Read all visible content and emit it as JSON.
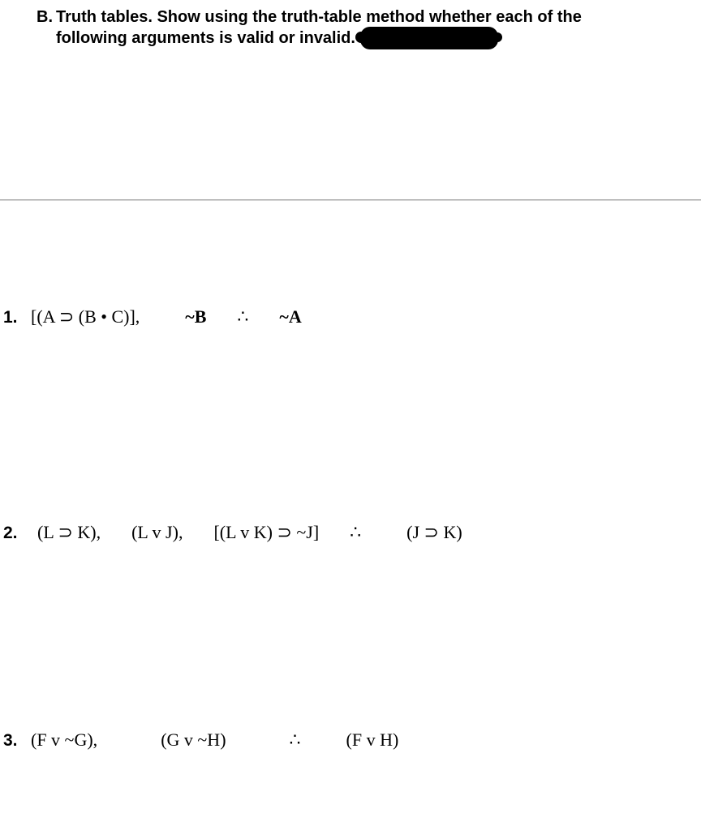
{
  "header": {
    "section_label": "B.",
    "line1": "Truth tables. Show using the truth-table method whether each of the",
    "line2": "following arguments is valid or invalid."
  },
  "problems": {
    "p1": {
      "num": "1.",
      "premise1": "[(A ⊃ (B • C)],",
      "premise2": "~B",
      "therefore": "∴",
      "conclusion": "~A"
    },
    "p2": {
      "num": "2.",
      "premise1": "(L ⊃ K),",
      "premise2": "(L v J),",
      "premise3": "[(L v K) ⊃ ~J]",
      "therefore": "∴",
      "conclusion": "(J ⊃ K)"
    },
    "p3": {
      "num": "3.",
      "premise1": "(F v ~G),",
      "premise2": "(G v ~H)",
      "therefore": "∴",
      "conclusion": "(F v H)"
    }
  }
}
